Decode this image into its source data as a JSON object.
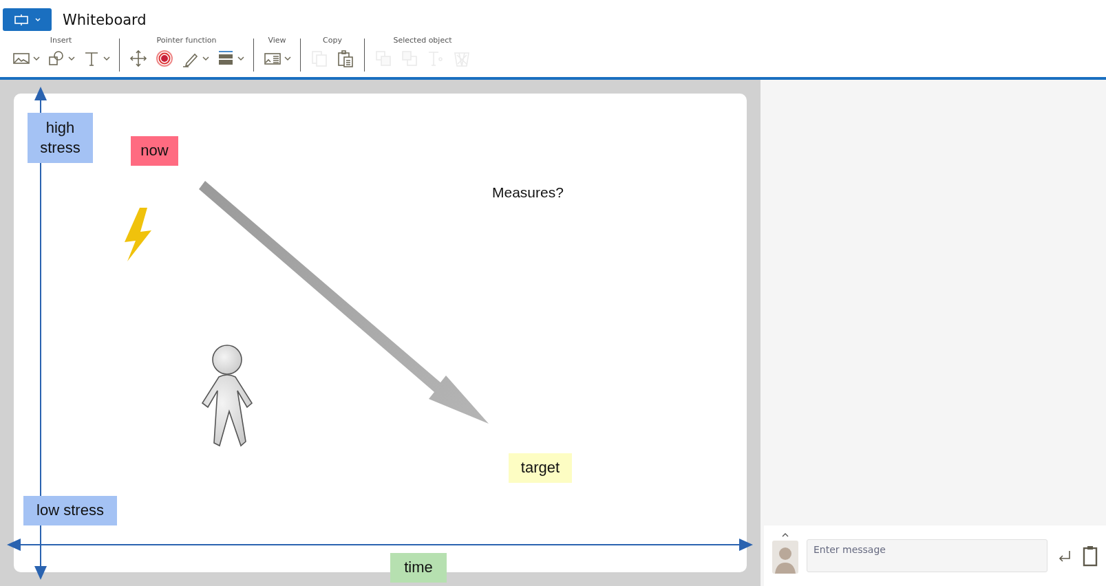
{
  "window": {
    "title": "Whiteboard"
  },
  "toolbar": [
    {
      "label": "Insert",
      "buttons": [
        {
          "dropdown": true,
          "disabled": false
        },
        {
          "dropdown": true,
          "disabled": false
        },
        {
          "dropdown": true,
          "disabled": false
        }
      ]
    },
    {
      "label": "Pointer function",
      "buttons": [
        {
          "dropdown": false,
          "disabled": false
        },
        {
          "dropdown": false,
          "disabled": false
        },
        {
          "dropdown": true,
          "disabled": false
        },
        {
          "dropdown": true,
          "disabled": false
        }
      ]
    },
    {
      "label": "View",
      "buttons": [
        {
          "dropdown": true,
          "disabled": false
        }
      ]
    },
    {
      "label": "Copy",
      "buttons": [
        {
          "dropdown": false,
          "disabled": true
        },
        {
          "dropdown": false,
          "disabled": false
        }
      ]
    },
    {
      "label": "Selected object",
      "buttons": [
        {
          "dropdown": false,
          "disabled": true
        },
        {
          "dropdown": false,
          "disabled": true
        },
        {
          "dropdown": false,
          "disabled": true
        },
        {
          "dropdown": false,
          "disabled": true
        }
      ]
    }
  ],
  "board": {
    "items": [
      {
        "kind": "note",
        "text": "high stress",
        "color": "#a4c2f4"
      },
      {
        "kind": "note",
        "text": "now",
        "color": "#ff6b81"
      },
      {
        "kind": "label",
        "text": "Measures?"
      },
      {
        "kind": "note",
        "text": "target",
        "color": "#fdfdc3"
      },
      {
        "kind": "note",
        "text": "low stress",
        "color": "#a4c2f4"
      },
      {
        "kind": "note",
        "text": "time",
        "color": "#b6e0b0"
      }
    ]
  },
  "chat": {
    "placeholder": "Enter message"
  }
}
